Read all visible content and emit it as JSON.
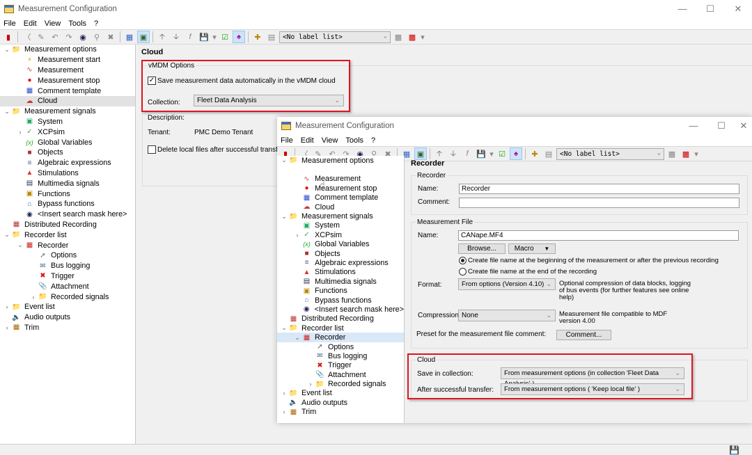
{
  "back_window": {
    "title": "Measurement Configuration",
    "menu": [
      "File",
      "Edit",
      "View",
      "Tools",
      "?"
    ],
    "label_list": "<No label list>",
    "tree": [
      {
        "label": "Measurement options",
        "level": 0,
        "expand": "v",
        "icon": "folder-icon"
      },
      {
        "label": "Measurement start",
        "level": 1,
        "icon": "measurement-start-icon"
      },
      {
        "label": "Measurement",
        "level": 1,
        "icon": "measurement-icon"
      },
      {
        "label": "Measurement stop",
        "level": 1,
        "icon": "measurement-stop-icon"
      },
      {
        "label": "Comment template",
        "level": 1,
        "icon": "comment-template-icon"
      },
      {
        "label": "Cloud",
        "level": 1,
        "icon": "cloud-icon",
        "selected": true
      },
      {
        "label": "Measurement signals",
        "level": 0,
        "expand": "v",
        "icon": "signals-folder-icon"
      },
      {
        "label": "System",
        "level": 1,
        "icon": "system-icon"
      },
      {
        "label": "XCPsim",
        "level": 1,
        "expand": ">",
        "icon": "xcpsim-icon"
      },
      {
        "label": "Global Variables",
        "level": 1,
        "icon": "global-variables-icon"
      },
      {
        "label": "Objects",
        "level": 1,
        "icon": "objects-icon"
      },
      {
        "label": "Algebraic expressions",
        "level": 1,
        "icon": "algebraic-icon"
      },
      {
        "label": "Stimulations",
        "level": 1,
        "icon": "stimulations-icon"
      },
      {
        "label": "Multimedia signals",
        "level": 1,
        "icon": "multimedia-icon"
      },
      {
        "label": "Functions",
        "level": 1,
        "icon": "functions-icon"
      },
      {
        "label": "Bypass functions",
        "level": 1,
        "icon": "bypass-icon"
      },
      {
        "label": "<Insert search mask here>",
        "level": 1,
        "icon": "binoculars-icon"
      },
      {
        "label": "Distributed Recording",
        "level": 0,
        "icon": "distributed-recording-icon"
      },
      {
        "label": "Recorder list",
        "level": 0,
        "expand": "v",
        "icon": "recorder-list-icon"
      },
      {
        "label": "Recorder",
        "level": 1,
        "expand": "v",
        "icon": "recorder-icon"
      },
      {
        "label": "Options",
        "level": 2,
        "icon": "options-icon"
      },
      {
        "label": "Bus logging",
        "level": 2,
        "icon": "bus-logging-icon"
      },
      {
        "label": "Trigger",
        "level": 2,
        "icon": "trigger-icon"
      },
      {
        "label": "Attachment",
        "level": 2,
        "icon": "attachment-icon"
      },
      {
        "label": "Recorded signals",
        "level": 2,
        "expand": ">",
        "icon": "recorded-signals-icon"
      },
      {
        "label": "Event list",
        "level": 0,
        "expand": ">",
        "icon": "event-list-icon"
      },
      {
        "label": "Audio outputs",
        "level": 0,
        "icon": "audio-icon"
      },
      {
        "label": "Trim",
        "level": 0,
        "expand": ">",
        "icon": "trim-icon"
      }
    ],
    "cloud_panel": {
      "heading": "Cloud",
      "group": "vMDM Options",
      "save_auto_label": "Save measurement data automatically in the vMDM cloud",
      "save_auto_checked": true,
      "collection_label": "Collection:",
      "collection_value": "Fleet Data Analysis",
      "description_label": "Description:",
      "tenant_label": "Tenant:",
      "tenant_value": "PMC Demo Tenant",
      "delete_local_label": "Delete local files after successful transfer",
      "delete_local_checked": false
    }
  },
  "front_window": {
    "title": "Measurement Configuration",
    "menu": [
      "File",
      "Edit",
      "View",
      "Tools",
      "?"
    ],
    "label_list": "<No label list>",
    "tree": [
      {
        "label": "Measurement options",
        "level": 0,
        "expand": "v",
        "icon": "folder-icon"
      },
      {
        "label": "",
        "level": 1,
        "icon": ""
      },
      {
        "label": "Measurement",
        "level": 1,
        "icon": "measurement-icon"
      },
      {
        "label": "Measurement stop",
        "level": 1,
        "icon": "measurement-stop-icon"
      },
      {
        "label": "Comment template",
        "level": 1,
        "icon": "comment-template-icon"
      },
      {
        "label": "Cloud",
        "level": 1,
        "icon": "cloud-icon"
      },
      {
        "label": "Measurement signals",
        "level": 0,
        "expand": "v",
        "icon": "signals-folder-icon"
      },
      {
        "label": "System",
        "level": 1,
        "icon": "system-icon"
      },
      {
        "label": "XCPsim",
        "level": 1,
        "expand": ">",
        "icon": "xcpsim-icon"
      },
      {
        "label": "Global Variables",
        "level": 1,
        "icon": "global-variables-icon"
      },
      {
        "label": "Objects",
        "level": 1,
        "icon": "objects-icon"
      },
      {
        "label": "Algebraic expressions",
        "level": 1,
        "icon": "algebraic-icon"
      },
      {
        "label": "Stimulations",
        "level": 1,
        "icon": "stimulations-icon"
      },
      {
        "label": "Multimedia signals",
        "level": 1,
        "icon": "multimedia-icon"
      },
      {
        "label": "Functions",
        "level": 1,
        "icon": "functions-icon"
      },
      {
        "label": "Bypass functions",
        "level": 1,
        "icon": "bypass-icon"
      },
      {
        "label": "<Insert search mask here>",
        "level": 1,
        "icon": "binoculars-icon"
      },
      {
        "label": "Distributed Recording",
        "level": 0,
        "icon": "distributed-recording-icon"
      },
      {
        "label": "Recorder list",
        "level": 0,
        "expand": "v",
        "icon": "recorder-list-icon"
      },
      {
        "label": "Recorder",
        "level": 1,
        "expand": "v",
        "icon": "recorder-icon",
        "selected": true
      },
      {
        "label": "Options",
        "level": 2,
        "icon": "options-icon"
      },
      {
        "label": "Bus logging",
        "level": 2,
        "icon": "bus-logging-icon"
      },
      {
        "label": "Trigger",
        "level": 2,
        "icon": "trigger-icon"
      },
      {
        "label": "Attachment",
        "level": 2,
        "icon": "attachment-icon"
      },
      {
        "label": "Recorded signals",
        "level": 2,
        "expand": ">",
        "icon": "recorded-signals-icon"
      },
      {
        "label": "Event list",
        "level": 0,
        "expand": ">",
        "icon": "event-list-icon"
      },
      {
        "label": "Audio outputs",
        "level": 0,
        "icon": "audio-icon"
      },
      {
        "label": "Trim",
        "level": 0,
        "expand": ">",
        "icon": "trim-icon"
      }
    ],
    "recorder_panel": {
      "heading": "Recorder",
      "recorder_group": "Recorder",
      "name_label": "Name:",
      "name_value": "Recorder",
      "comment_label": "Comment:",
      "comment_value": "",
      "file_group": "Measurement File",
      "file_name_label": "Name:",
      "file_name_value": "CANape.MF4",
      "browse_label": "Browse...",
      "macro_label": "Macro",
      "radio_begin_label": "Create file name at the beginning of the measurement or after the previous recording",
      "radio_end_label": "Create file name at the end of the recording",
      "radio_selected": "begin",
      "format_label": "Format:",
      "format_value": "From options (Version 4.10)",
      "format_note": "Optional compression of data blocks, logging of bus events (for further features see online help)",
      "compression_label": "Compression:",
      "compression_value": "None",
      "compression_note": "Measurement file compatible to MDF version 4.00",
      "preset_label": "Preset for the measurement file comment:",
      "comment_button": "Comment...",
      "cloud_group": "Cloud",
      "save_in_collection_label": "Save in collection:",
      "save_in_collection_value": "From measurement options (in collection 'Fleet Data Analysis' )",
      "after_transfer_label": "After successful transfer:",
      "after_transfer_value": "From measurement options ( 'Keep local file' )"
    }
  },
  "colors": {
    "highlight": "#e0141e",
    "selection": "#d9e8f7"
  }
}
